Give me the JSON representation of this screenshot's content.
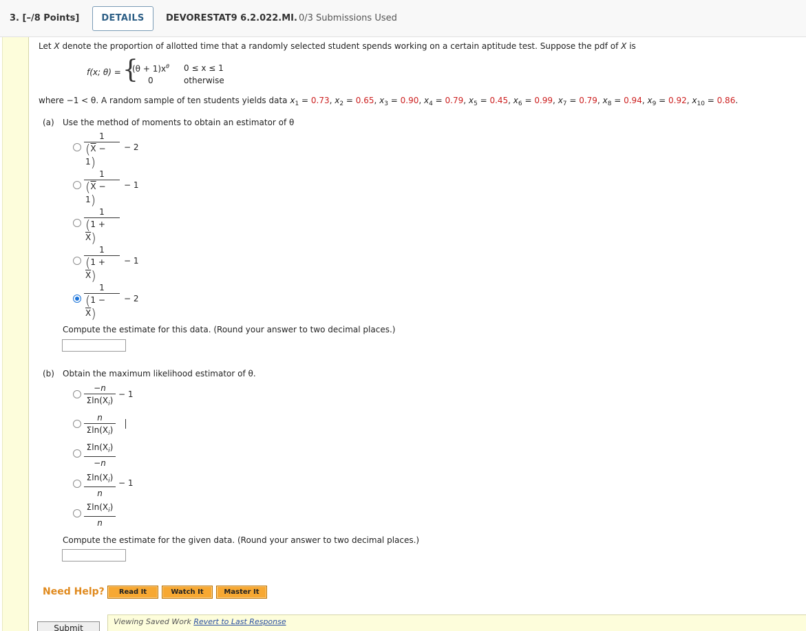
{
  "header": {
    "question_number": "3.  [–/8 Points]",
    "details_label": "DETAILS",
    "code": "DEVORESTAT9 6.2.022.MI.",
    "submissions": "0/3 Submissions Used"
  },
  "problem": {
    "intro_a": "Let ",
    "intro_var": "X",
    "intro_b": " denote the proportion of allotted time that a randomly selected student spends working on a certain aptitude test. Suppose the pdf of ",
    "intro_var2": "X",
    "intro_c": " is",
    "pdf_lhs": "f(x; θ) =",
    "pdf_case1": "(θ + 1)x",
    "pdf_case1_exp": "θ",
    "pdf_cond1": "0 ≤ x ≤ 1",
    "pdf_case2": "0",
    "pdf_cond2": "otherwise",
    "where_text": "where −1 < θ. A random sample of ten students yields data ",
    "data": [
      {
        "sub": "1",
        "value": "0.73"
      },
      {
        "sub": "2",
        "value": "0.65"
      },
      {
        "sub": "3",
        "value": "0.90"
      },
      {
        "sub": "4",
        "value": "0.79"
      },
      {
        "sub": "5",
        "value": "0.45"
      },
      {
        "sub": "6",
        "value": "0.99"
      },
      {
        "sub": "7",
        "value": "0.79"
      },
      {
        "sub": "8",
        "value": "0.94"
      },
      {
        "sub": "9",
        "value": "0.92"
      },
      {
        "sub": "10",
        "value": "0.86"
      }
    ]
  },
  "part_a": {
    "label": "(a)",
    "prompt": "Use the method of moments to obtain an estimator of θ",
    "options": [
      {
        "num": "1",
        "den_pre": "X",
        "den_op": " − 1",
        "suffix": "− 2",
        "selected": false
      },
      {
        "num": "1",
        "den_pre": "X",
        "den_op": " − 1",
        "suffix": "− 1",
        "selected": false
      },
      {
        "num": "1",
        "den_pre": "1 + ",
        "den_op": "X",
        "suffix": "",
        "selected": false
      },
      {
        "num": "1",
        "den_pre": "1 + ",
        "den_op": "X",
        "suffix": "− 1",
        "selected": false
      },
      {
        "num": "1",
        "den_pre": "1 − ",
        "den_op": "X",
        "suffix": "− 2",
        "selected": true
      }
    ],
    "compute_prompt": "Compute the estimate for this data. (Round your answer to two decimal places.)",
    "answer_value": ""
  },
  "part_b": {
    "label": "(b)",
    "prompt": "Obtain the maximum likelihood estimator of θ.",
    "options": [
      {
        "num": "−n",
        "den": "Σln(X",
        "suffix": "− 1",
        "selected": false
      },
      {
        "num": "n",
        "den": "Σln(X",
        "suffix": "",
        "selected": false
      },
      {
        "num": "Σln(X",
        "den": "−n",
        "suffix": "",
        "selected": false
      },
      {
        "num": "Σln(X",
        "den": "n",
        "suffix": "− 1",
        "selected": false
      },
      {
        "num": "Σln(X",
        "den": "n",
        "suffix": "",
        "selected": false
      }
    ],
    "compute_prompt": "Compute the estimate for the given data. (Round your answer to two decimal places.)",
    "answer_value": ""
  },
  "help": {
    "label": "Need Help?",
    "buttons": [
      "Read It",
      "Watch It",
      "Master It"
    ]
  },
  "footer": {
    "submit_label": "Submit Answer",
    "saved_text": "Viewing Saved Work ",
    "revert_link": "Revert to Last Response"
  },
  "colors": {
    "accent": "#2d5f86",
    "data_red": "#cc1f1f",
    "help_orange": "#e08a1e",
    "gutter_yellow": "#fdfddb",
    "radio_blue": "#1a73d9"
  }
}
